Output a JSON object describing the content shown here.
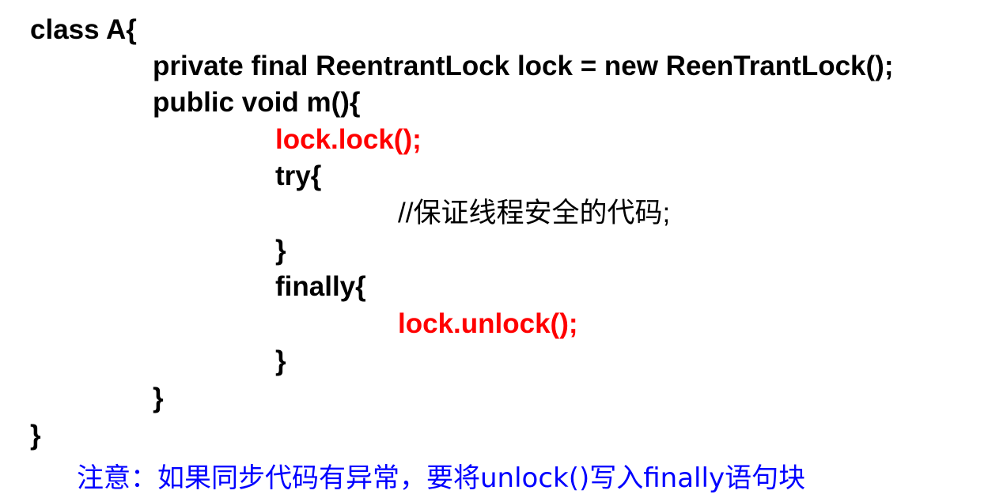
{
  "code": {
    "line_class": "class A{",
    "line_field": "private final ReentrantLock lock = new ReenTrantLock();",
    "line_method": "public void m(){",
    "line_lock": "lock.lock();",
    "line_try": "try{",
    "line_comment": "//保证线程安全的代码;",
    "line_try_close": "}",
    "line_finally": "finally{",
    "line_unlock": "lock.unlock();",
    "line_finally_close": "}",
    "line_method_close": "}",
    "line_class_close": "}"
  },
  "note": {
    "text": "注意：如果同步代码有异常，要将unlock()写入finally语句块"
  },
  "colors": {
    "code": "#000000",
    "highlight": "#ff0000",
    "note": "#0000ff"
  }
}
